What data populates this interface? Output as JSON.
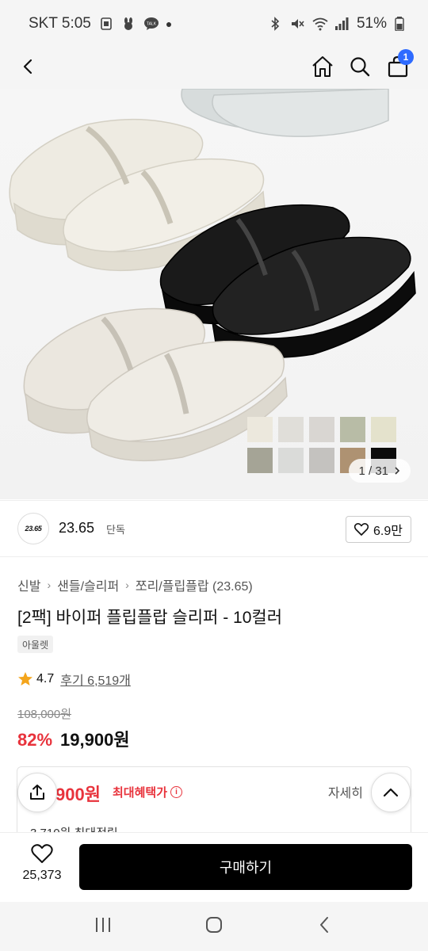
{
  "status_bar": {
    "carrier_time": "SKT 5:05",
    "battery": "51%"
  },
  "header": {
    "cart_count": "1"
  },
  "gallery": {
    "counter": "1 / 31",
    "swatch_colors": [
      "#ece8dd",
      "#e0ded9",
      "#d9d6d2",
      "#b8bca6",
      "#e4e2cc",
      "#a5a496",
      "#dadbd9",
      "#c4c2bf",
      "#ae9272",
      "#0b0b0b"
    ]
  },
  "brand": {
    "logo_text": "23.65",
    "name": "23.65",
    "tag": "단독",
    "likes": "6.9만"
  },
  "breadcrumb": [
    "신발",
    "샌들/슬리퍼",
    "쪼리/플립플랍 (23.65)"
  ],
  "product": {
    "title": "[2팩] 바이퍼 플립플랍 슬리퍼 - 10컬러",
    "badge": "아울렛",
    "rating": "4.7",
    "reviews": "후기 6,519개",
    "original_price": "108,000원",
    "discount": "82%",
    "price": "19,900원"
  },
  "benefit": {
    "price": "900원",
    "label": "최대혜택가",
    "detail": "자세히",
    "sub": "3,710원 최대적립"
  },
  "bottom": {
    "wish_count": "25,373",
    "buy_label": "구매하기"
  }
}
